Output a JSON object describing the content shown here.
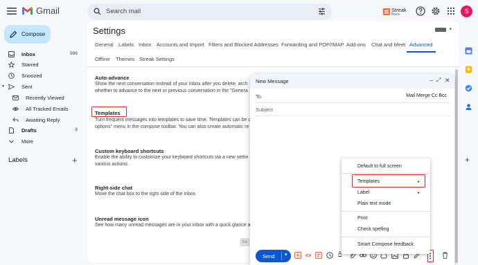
{
  "header": {
    "app_name": "Gmail",
    "search_placeholder": "Search mail",
    "streak_name": "Streak",
    "streak_sub": "Basic",
    "avatar_letter": "S"
  },
  "sidebar": {
    "compose_label": "Compose",
    "items": [
      {
        "label": "Inbox",
        "count": "996",
        "bold": true
      },
      {
        "label": "Starred"
      },
      {
        "label": "Snoozed"
      },
      {
        "label": "Sent"
      },
      {
        "label": "Recently Viewed"
      },
      {
        "label": "All Tracked Emails"
      },
      {
        "label": "Awaiting Reply"
      },
      {
        "label": "Drafts",
        "count": "8",
        "bold": true
      },
      {
        "label": "More"
      }
    ],
    "labels_title": "Labels",
    "labels_add": "+"
  },
  "settings": {
    "title": "Settings",
    "tabs_row1": [
      "General",
      "Labels",
      "Inbox",
      "Accounts and Import",
      "Filters and Blocked Addresses",
      "Forwarding and POP/IMAP",
      "Add-ons",
      "Chat and Meet",
      "Advanced"
    ],
    "tabs_row2": [
      "Offline",
      "Themes",
      "Streak Settings"
    ],
    "active_tab": "Advanced",
    "sections": [
      {
        "title": "Auto-advance",
        "body": [
          "Show the next conversation instead of your inbox after you delete, arch",
          "whether to advance to the next or previous conversation in the \"Genera"
        ]
      },
      {
        "title": "Templates",
        "body": [
          "Turn frequent messages into templates to save time. Templates can be c",
          "options\" menu in the compose toolbar. You can also create automatic re"
        ]
      },
      {
        "title": "Custom keyboard shortcuts",
        "body": [
          "Enable the ability to customize your keyboard shortcuts via a new settin",
          "various actions."
        ]
      },
      {
        "title": "Right-side chat",
        "body": [
          "Move the chat box to the right side of the inbox."
        ]
      },
      {
        "title": "Unread message icon",
        "body": [
          "See how many unread messages are in your inbox with a quick glance a"
        ]
      }
    ],
    "save_partial": "Sa"
  },
  "compose_window": {
    "title": "New Message",
    "to_label": "To",
    "to_extras": "Mail Merge  Cc  Bcc",
    "subject_placeholder": "Subject",
    "send_label": "Send"
  },
  "more_menu": {
    "items": [
      "Default to full screen",
      "Templates",
      "Label",
      "Plain text mode",
      "Print",
      "Check spelling",
      "Smart Compose feedback"
    ]
  },
  "colors": {
    "accent_blue": "#0b57d0",
    "compose_bg": "#c2e7ff",
    "highlight_red": "#d93025",
    "gmail_red": "#ea4335",
    "avatar_pink": "#e8175d",
    "streak_orange": "#f26c3d"
  },
  "icons": [
    "menu-icon",
    "gmail-logo-icon",
    "search-icon",
    "tune-icon",
    "streak-icon",
    "help-icon",
    "settings-gear-icon",
    "apps-grid-icon",
    "pencil-icon",
    "inbox-icon",
    "star-icon",
    "clock-icon",
    "send-icon",
    "envelope-icon",
    "eye-icon",
    "reply-icon",
    "draft-icon",
    "chevron-down-icon",
    "calendar-icon",
    "keep-icon",
    "tasks-icon",
    "contacts-icon",
    "minimize-icon",
    "pop-out-icon",
    "close-icon",
    "more-vert-icon",
    "trash-icon"
  ]
}
